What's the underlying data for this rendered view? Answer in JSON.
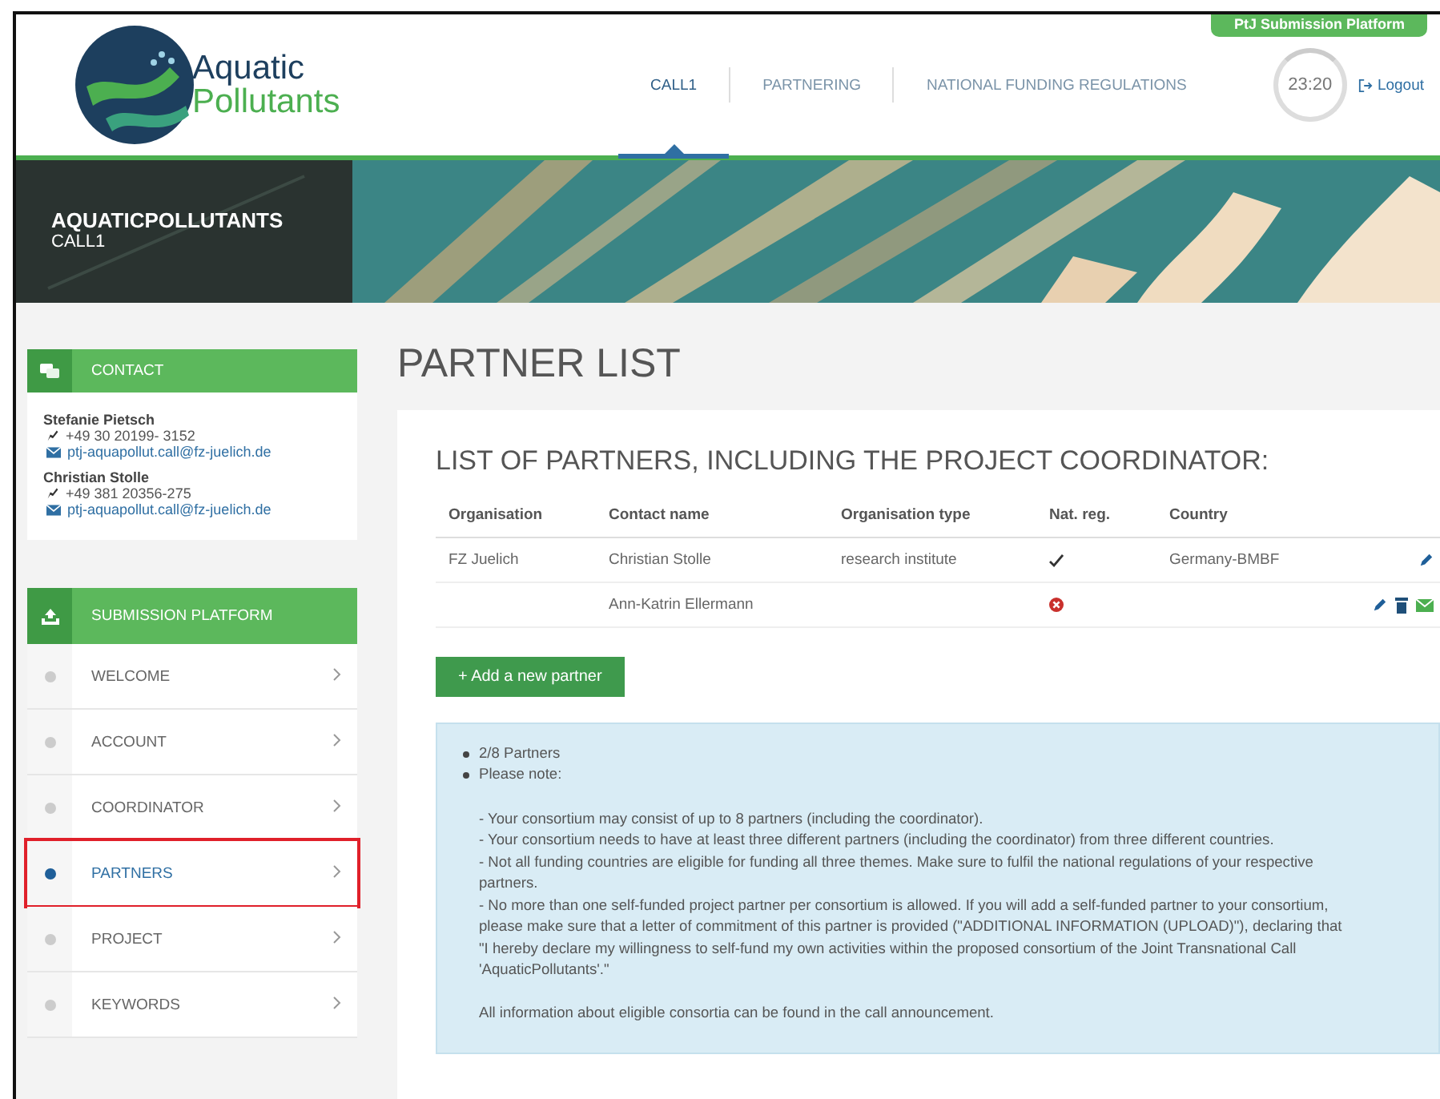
{
  "header": {
    "platform_badge": "PtJ Submission Platform",
    "logo": {
      "line1": "Aquatic",
      "line2": "Pollutants"
    },
    "nav": [
      {
        "label": "CALL1",
        "selected": true
      },
      {
        "label": "PARTNERING",
        "selected": false
      },
      {
        "label": "NATIONAL FUNDING REGULATIONS",
        "selected": false
      }
    ],
    "timer": "23:20",
    "logout": "Logout"
  },
  "banner": {
    "title": "AQUATICPOLLUTANTS",
    "subtitle": "CALL1"
  },
  "sidebar": {
    "contact": {
      "title": "CONTACT",
      "people": [
        {
          "name": "Stefanie Pietsch",
          "phone": "+49 30 20199- 3152",
          "email": "ptj-aquapollut.call@fz-juelich.de"
        },
        {
          "name": "Christian Stolle",
          "phone": "+49 381 20356-275",
          "email": "ptj-aquapollut.call@fz-juelich.de"
        }
      ]
    },
    "submission": {
      "title": "SUBMISSION PLATFORM",
      "items": [
        {
          "label": "WELCOME",
          "selected": false,
          "highlighted": false
        },
        {
          "label": "ACCOUNT",
          "selected": false,
          "highlighted": false
        },
        {
          "label": "COORDINATOR",
          "selected": false,
          "highlighted": false
        },
        {
          "label": "PARTNERS",
          "selected": true,
          "highlighted": true
        },
        {
          "label": "PROJECT",
          "selected": false,
          "highlighted": false
        },
        {
          "label": "KEYWORDS",
          "selected": false,
          "highlighted": false
        }
      ]
    }
  },
  "main": {
    "title": "PARTNER LIST",
    "heading": "LIST OF PARTNERS, INCLUDING THE PROJECT COORDINATOR:",
    "table": {
      "columns": [
        "Organisation",
        "Contact name",
        "Organisation type",
        "Nat. reg.",
        "Country"
      ],
      "rows": [
        {
          "organisation": "FZ Juelich",
          "contact": "Christian Stolle",
          "type": "research institute",
          "country": "Germany-BMBF",
          "registered": true,
          "can_delete": false,
          "can_mail": false
        },
        {
          "contact": "Ann-Katrin Ellermann",
          "registered": false,
          "can_delete": true,
          "can_mail": true
        }
      ]
    },
    "add_button": "+ Add a new partner",
    "notes": {
      "bullets": [
        "2/8 Partners",
        "Please note:"
      ],
      "lines": [
        "- Your consortium may consist of up to 8 partners (including the coordinator).",
        "- Your consortium needs to have at least three different partners (including the coordinator) from three different countries.",
        "- Not all funding countries are eligible for funding all three themes. Make sure to fulfil the national regulations of your respective partners.",
        "- No more than one self-funded project partner per consortium is allowed. If you will add a self-funded partner to your consortium, please make sure that a letter of commitment of this partner is provided (\"ADDITIONAL INFORMATION (UPLOAD)\"), declaring that \"I hereby declare my willingness to self-fund my own activities within the proposed consortium of the Joint Transnational Call 'AquaticPollutants'.\""
      ],
      "footer": "All information about eligible consortia can be found in the call announcement."
    }
  }
}
